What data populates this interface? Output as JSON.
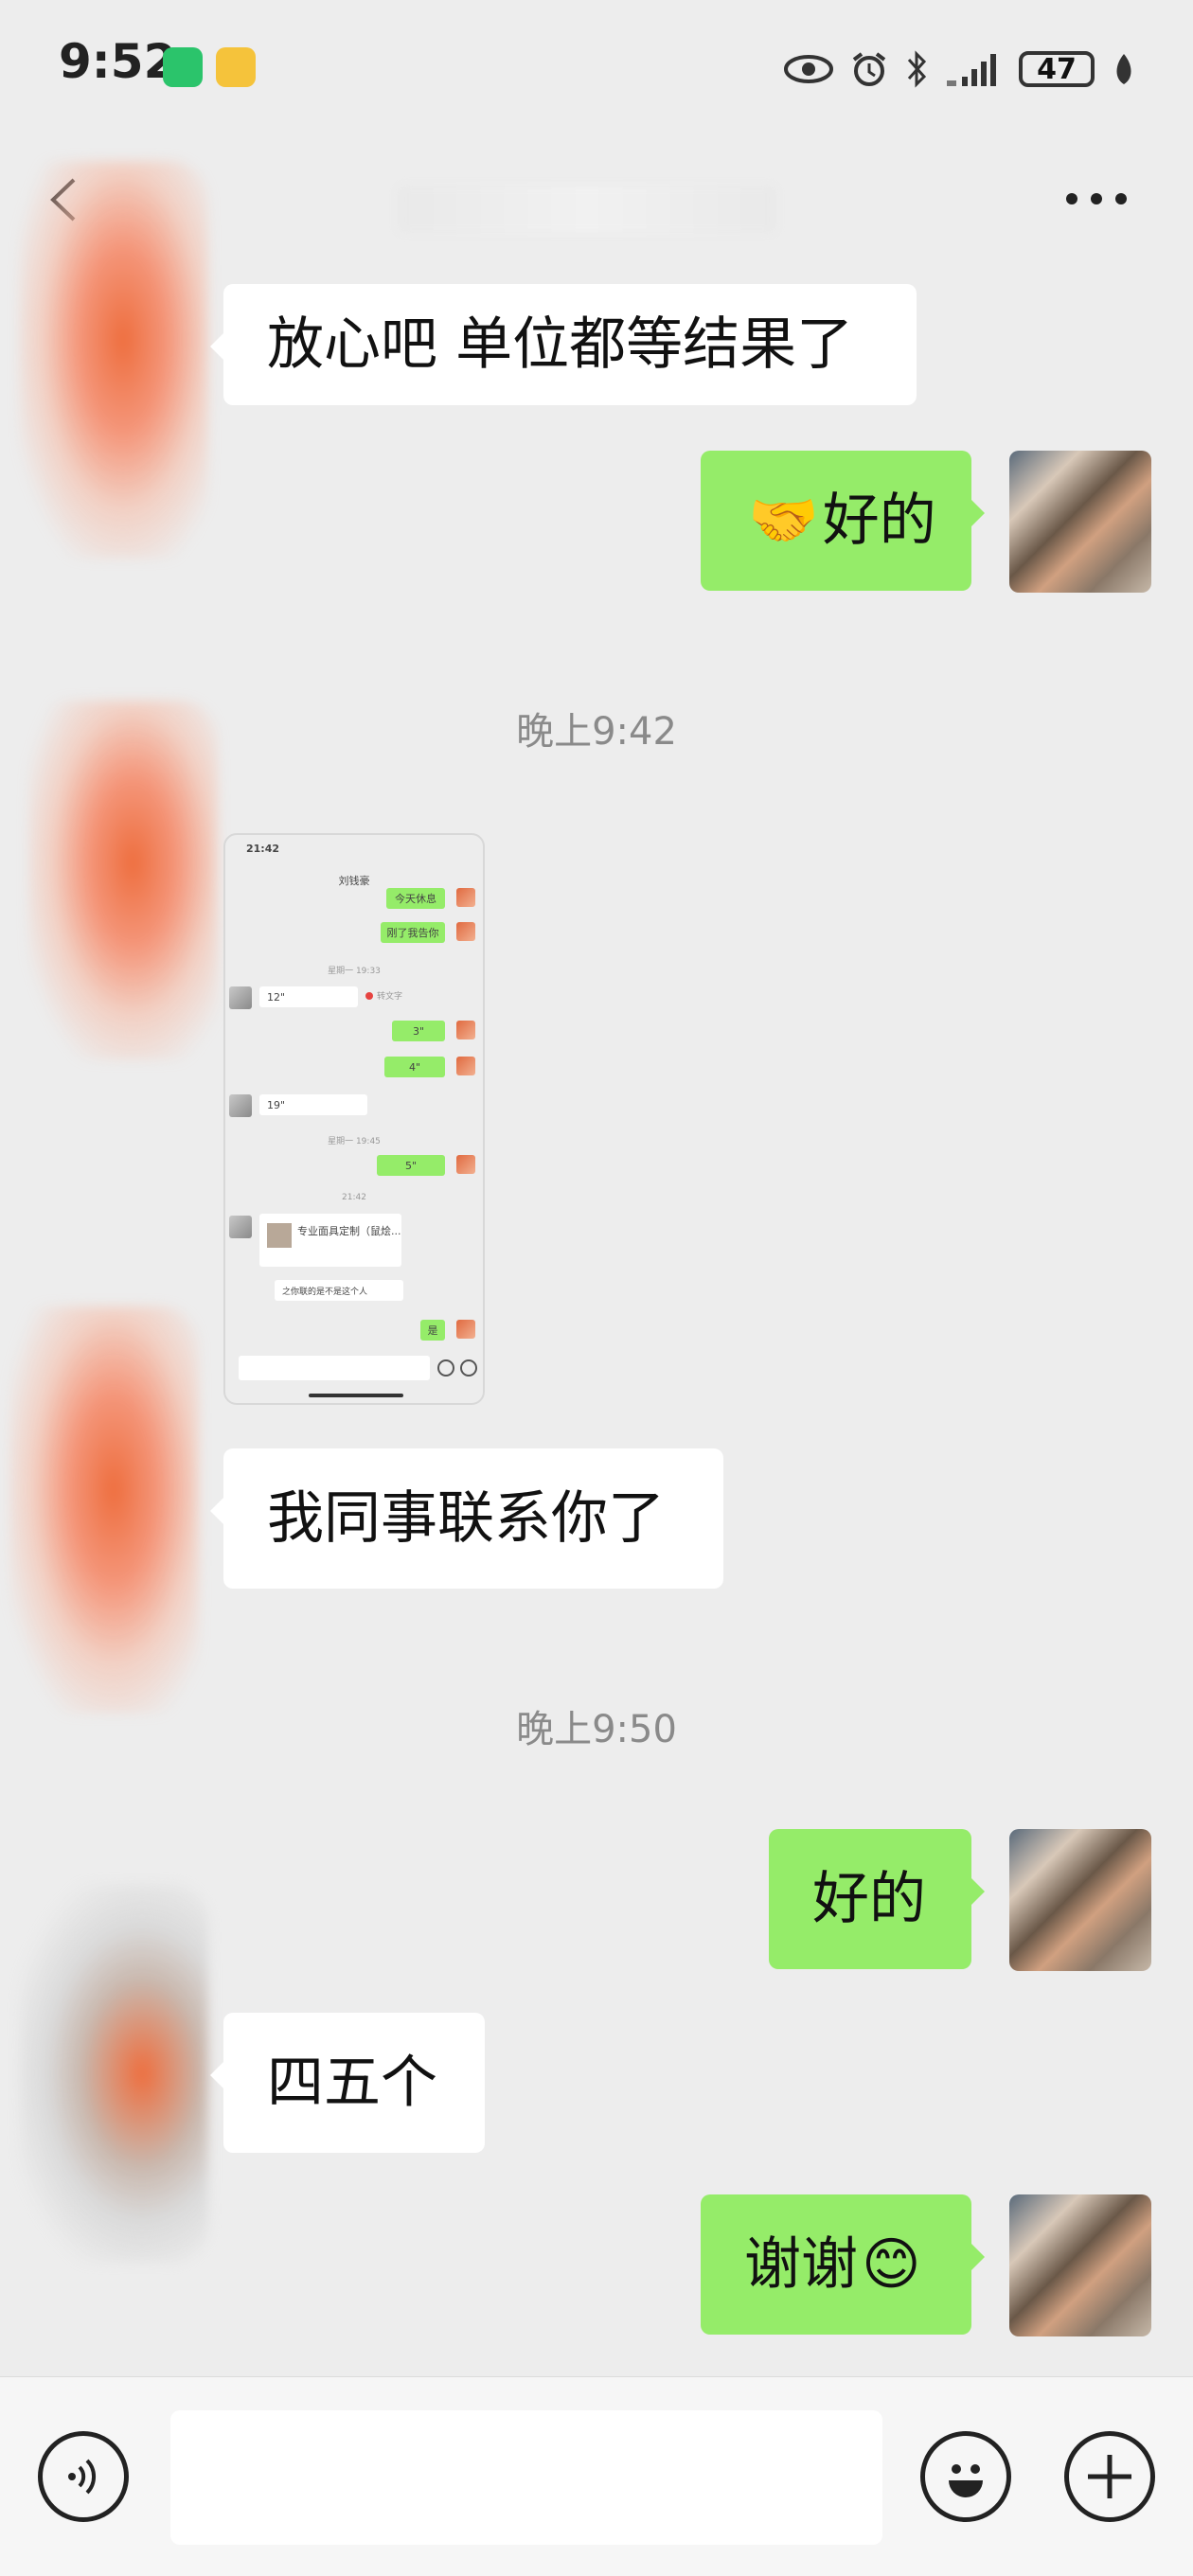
{
  "status_bar": {
    "time": "9:52",
    "battery": "47"
  },
  "header": {
    "more_label": "•••"
  },
  "messages": [
    {
      "from": "other",
      "text": "放心吧 单位都等结果了"
    },
    {
      "from": "self",
      "emoji": "🤝",
      "text": "好的"
    },
    {
      "timestamp": "晚上9:42"
    },
    {
      "from": "other",
      "type": "image"
    },
    {
      "from": "other",
      "text": "我同事联系你了"
    },
    {
      "timestamp": "晚上9:50"
    },
    {
      "from": "self",
      "text": "好的"
    },
    {
      "from": "other",
      "text": "四五个"
    },
    {
      "from": "self",
      "text": "谢谢",
      "emoji": "😊"
    }
  ],
  "mini": {
    "time": "21:42",
    "title": "刘钱豪",
    "g1": "今天休息",
    "g2": "刚了我告你",
    "ts1": "星期一 19:33",
    "v1": "12\"",
    "tag": "转文字",
    "g3": "3\"",
    "g4": "4\"",
    "v2": "19\"",
    "ts2": "星期一 19:45",
    "g5": "5\"",
    "ts3": "21:42",
    "card": "专业面具定制（鼠烩...",
    "q": "之你联的是不是这个人",
    "yes": "是"
  },
  "colors": {
    "self_bubble": "#95ec69",
    "other_bubble": "#ffffff",
    "background": "#ededed"
  }
}
